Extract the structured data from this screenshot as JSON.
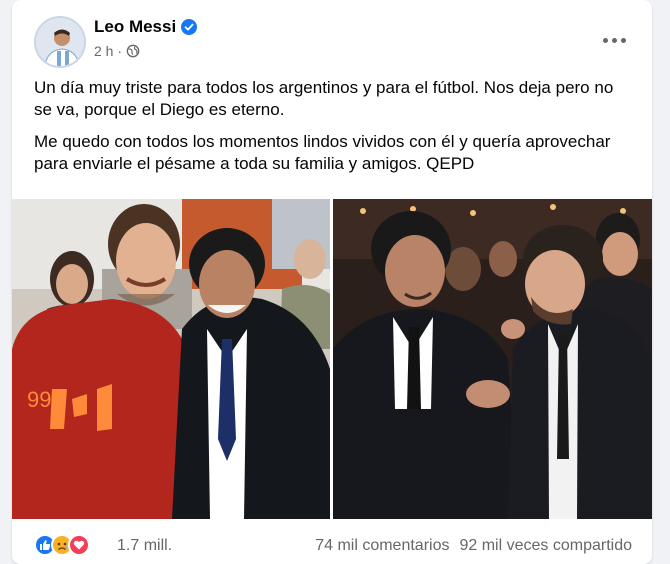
{
  "post": {
    "author": "Leo Messi",
    "time": "2 h ·",
    "paragraphs": [
      "Un día muy triste para todos los argentinos y para el fútbol. Nos deja pero no se va, porque el Diego es eterno.",
      "Me quedo con todos los momentos lindos vividos con él y quería aprovechar para enviarle el pésame a toda su familia y amigos. QEPD"
    ]
  },
  "reactions": {
    "icons": [
      "like-icon",
      "sad-icon",
      "love-icon"
    ],
    "count": "1.7 mill."
  },
  "stats": {
    "comments": "74 mil comentarios",
    "shares": "92 mil veces compartido"
  },
  "colors": {
    "accent": "#1877f2",
    "muted": "#65676b",
    "love": "#f33e58",
    "sad": "#f7b125"
  }
}
